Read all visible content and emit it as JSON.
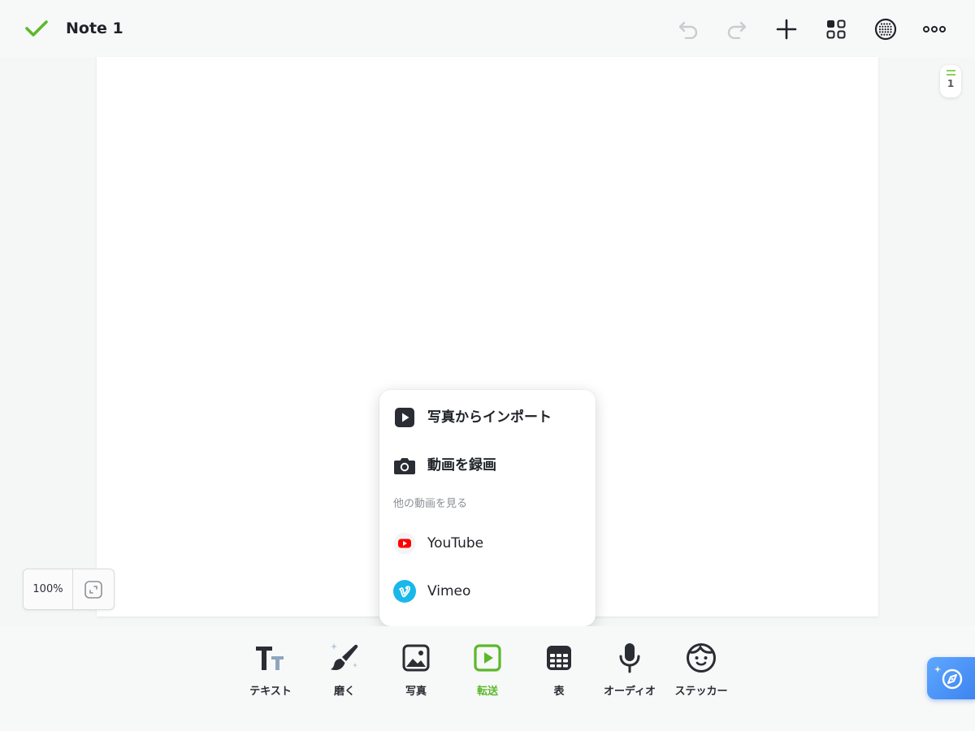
{
  "app": {
    "note_title": "Note 1",
    "accent_color": "#5cb82a",
    "icons": {
      "done": "check-icon",
      "undo": "undo-icon",
      "redo": "redo-icon",
      "add": "plus-icon",
      "pages": "grid-icon",
      "background": "dot-grid-icon",
      "more": "more-icon"
    }
  },
  "page_indicator": {
    "current": "1"
  },
  "zoom": {
    "level": "100%",
    "fit_icon": "fit-page-icon"
  },
  "video_menu": {
    "items": [
      {
        "label": "写真からインポート",
        "icon": "play-square-icon"
      },
      {
        "label": "動画を録画",
        "icon": "camera-icon"
      }
    ],
    "section_title": "他の動画を見る",
    "services": [
      {
        "label": "YouTube",
        "icon": "youtube-icon",
        "color": "#ff0000"
      },
      {
        "label": "Vimeo",
        "icon": "vimeo-icon",
        "color": "#1ab7ea"
      }
    ]
  },
  "toolbar": {
    "tools": [
      {
        "label": "テキスト",
        "icon": "text-icon"
      },
      {
        "label": "磨く",
        "icon": "brush-icon"
      },
      {
        "label": "写真",
        "icon": "photo-icon"
      },
      {
        "label": "転送",
        "icon": "video-icon",
        "active": true
      },
      {
        "label": "表",
        "icon": "table-icon"
      },
      {
        "label": "オーディオ",
        "icon": "microphone-icon"
      },
      {
        "label": "ステッカー",
        "icon": "sticker-icon"
      }
    ]
  },
  "assistant": {
    "icon": "compass-icon"
  }
}
